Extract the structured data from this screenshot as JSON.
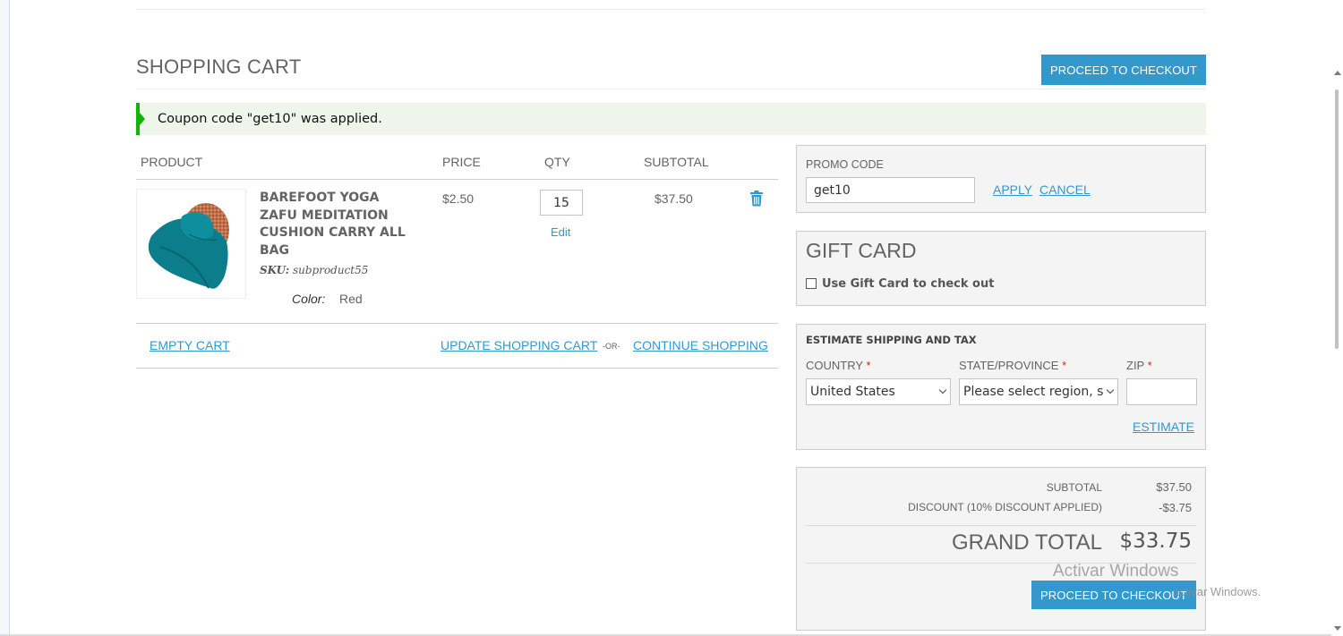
{
  "page": {
    "title": "SHOPPING CART",
    "proceed_top_label": "PROCEED TO CHECKOUT",
    "proceed_bottom_label": "PROCEED TO CHECKOUT"
  },
  "message": {
    "success": "Coupon code \"get10\" was applied."
  },
  "table": {
    "headers": {
      "product": "PRODUCT",
      "price": "PRICE",
      "qty": "QTY",
      "subtotal": "SUBTOTAL"
    }
  },
  "item": {
    "name": "BAREFOOT YOGA ZAFU MEDITATION CUSHION CARRY ALL BAG",
    "sku_label": "SKU:",
    "sku_value": "subproduct55",
    "option_label": "Color:",
    "option_value": "Red",
    "price": "$2.50",
    "qty": "15",
    "edit_label": "Edit",
    "subtotal": "$37.50",
    "image_icon": "product-thumbnail",
    "remove_icon": "trash-icon"
  },
  "actions": {
    "empty_cart": "EMPTY CART",
    "update_cart": "UPDATE SHOPPING CART",
    "or": "-OR-",
    "continue_shopping": "CONTINUE SHOPPING"
  },
  "promo": {
    "label": "PROMO CODE",
    "value": "get10",
    "apply": "APPLY",
    "cancel": "CANCEL"
  },
  "gift": {
    "title": "GIFT CARD",
    "checkbox_label": "Use Gift Card to check out",
    "checked": false
  },
  "shipping": {
    "title": "ESTIMATE SHIPPING AND TAX",
    "country_label": "COUNTRY",
    "country_value": "United States",
    "state_label": "STATE/PROVINCE",
    "state_value": "Please select region, s",
    "zip_label": "ZIP",
    "zip_value": "",
    "required_mark": "*",
    "estimate": "ESTIMATE"
  },
  "totals": {
    "subtotal_label": "SUBTOTAL",
    "subtotal_value": "$37.50",
    "discount_label": "DISCOUNT (10% DISCOUNT APPLIED)",
    "discount_value": "-$3.75",
    "grand_label": "GRAND TOTAL",
    "grand_value": "$33.75"
  },
  "watermark": {
    "title": "Activar Windows",
    "subtitle": "activar Windows."
  },
  "colors": {
    "accent": "#3399cc",
    "success_border": "#11b400",
    "success_bg": "#eff5ea",
    "required": "#df280a",
    "panel_bg": "#f4f4f4"
  }
}
